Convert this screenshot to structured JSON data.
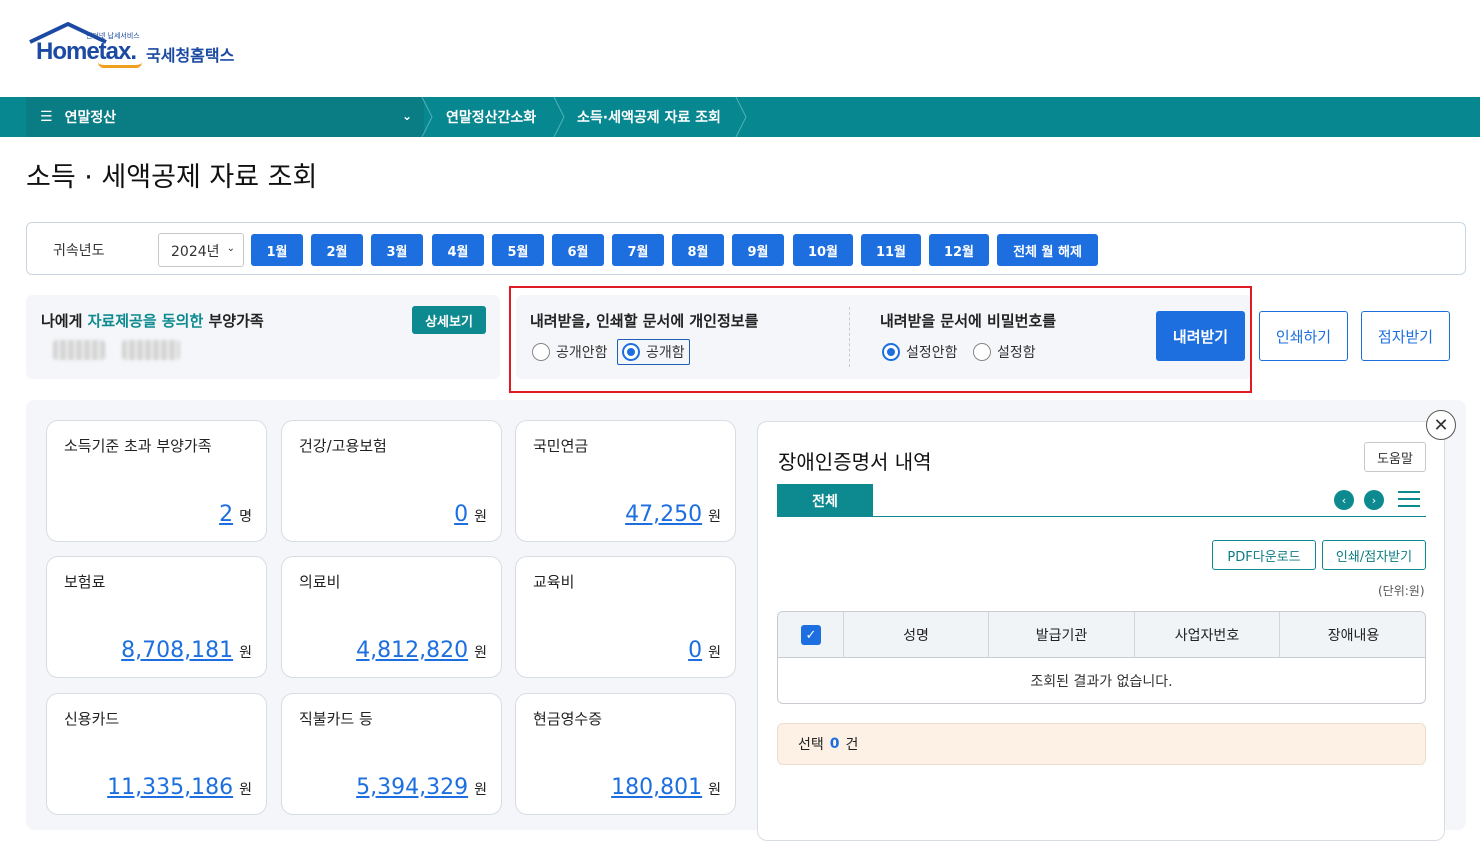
{
  "header": {
    "logo_text": "Hometax.",
    "logo_tagline": "인터넷 납세서비스",
    "logo_kr": "국세청홈택스"
  },
  "nav": {
    "menu_label": "연말정산",
    "crumb1": "연말정산간소화",
    "crumb2": "소득·세액공제 자료 조회"
  },
  "page": {
    "title": "소득 · 세액공제 자료 조회"
  },
  "yearbar": {
    "label": "귀속년도",
    "selected_year": "2024년",
    "months": [
      "1월",
      "2월",
      "3월",
      "4월",
      "5월",
      "6월",
      "7월",
      "8월",
      "9월",
      "10월",
      "11월",
      "12월"
    ],
    "clear_label": "전체 월 해제"
  },
  "dependents": {
    "text_pre": "나에게 ",
    "text_hl": "자료제공을 동의한",
    "text_post": " 부양가족",
    "detail_label": "상세보기"
  },
  "privacy": {
    "q1": "내려받을, 인쇄할 문서에 개인정보를",
    "q1_opt1": "공개안함",
    "q1_opt2": "공개함",
    "q1_selected": "공개함",
    "q2": "내려받을 문서에 비밀번호를",
    "q2_opt1": "설정안함",
    "q2_opt2": "설정함",
    "q2_selected": "설정안함",
    "download_label": "내려받기",
    "print_label": "인쇄하기",
    "braille_label": "점자받기"
  },
  "cards": [
    {
      "name": "소득기준 초과 부양가족",
      "value": "2",
      "unit": "명"
    },
    {
      "name": "건강/고용보험",
      "value": "0",
      "unit": "원"
    },
    {
      "name": "국민연금",
      "value": "47,250",
      "unit": "원"
    },
    {
      "name": "보험료",
      "value": "8,708,181",
      "unit": "원"
    },
    {
      "name": "의료비",
      "value": "4,812,820",
      "unit": "원"
    },
    {
      "name": "교육비",
      "value": "0",
      "unit": "원"
    },
    {
      "name": "신용카드",
      "value": "11,335,186",
      "unit": "원"
    },
    {
      "name": "직불카드 등",
      "value": "5,394,329",
      "unit": "원"
    },
    {
      "name": "현금영수증",
      "value": "180,801",
      "unit": "원"
    }
  ],
  "panel": {
    "title": "장애인증명서 내역",
    "help_label": "도움말",
    "close_glyph": "✕",
    "tab_all": "전체",
    "pdf_label": "PDF다운로드",
    "print_braille_label": "인쇄/점자받기",
    "unit_label": "(단위:원)",
    "columns": [
      "성명",
      "발급기관",
      "사업자번호",
      "장애내용"
    ],
    "empty_text": "조회된 결과가 없습니다.",
    "selection_pre": "선택",
    "selection_count": "0",
    "selection_post": "건"
  }
}
